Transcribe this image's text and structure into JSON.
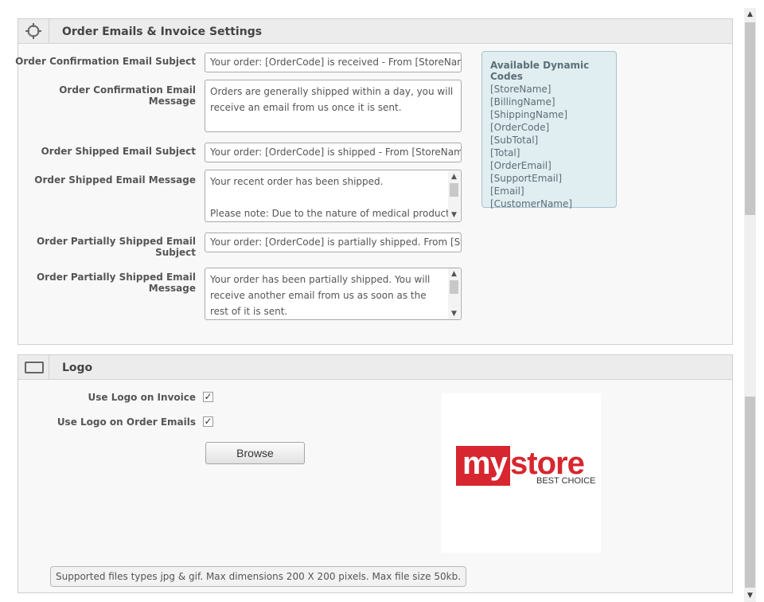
{
  "order_section": {
    "title": "Order Emails & Invoice Settings",
    "icon": "crosshair-icon",
    "fields": {
      "confirm_subject": {
        "label": "Order Confirmation Email Subject",
        "value": "Your order: [OrderCode] is received - From [StoreName]"
      },
      "confirm_message": {
        "label": "Order Confirmation Email Message",
        "value": "Orders are generally shipped within  a day, you will receive an email from us once it is sent."
      },
      "shipped_subject": {
        "label": "Order Shipped Email Subject",
        "value": "Your order: [OrderCode] is shipped - From [StoreName]"
      },
      "shipped_message": {
        "label": "Order Shipped Email Message",
        "line1": "Your recent order has been shipped.",
        "line2": "",
        "line3": "Please note: Due to the nature of medical products, we"
      },
      "partial_subject": {
        "label_line1": "Order Partially Shipped Email",
        "label_line2": "Subject",
        "value": "Your order: [OrderCode] is partially shipped. From [StoreName]"
      },
      "partial_message": {
        "label_line1": "Order Partially Shipped Email",
        "label_line2": "Message",
        "value": "Your order has been partially shipped. You will receive another email from us as soon as the rest of it is sent."
      }
    },
    "codes": {
      "title": "Available Dynamic Codes",
      "items": [
        "[StoreName]",
        "[BillingName]",
        "[ShippingName]",
        "[OrderCode]",
        "[SubTotal]",
        "[Total]",
        "[OrderEmail]",
        "[SupportEmail]",
        "[Email]",
        "[CustomerName]"
      ]
    }
  },
  "logo_section": {
    "title": "Logo",
    "icon": "rectangle-icon",
    "use_on_invoice": {
      "label": "Use Logo on Invoice",
      "checked": true,
      "mark": "✓"
    },
    "use_on_emails": {
      "label": "Use Logo on Order Emails",
      "checked": true,
      "mark": "✓"
    },
    "browse_label": "Browse",
    "logo": {
      "word_my": "my",
      "word_store": "store",
      "tagline": "BEST CHOICE",
      "brand_red": "#d7262f"
    },
    "note": "Supported files types jpg & gif. Max dimensions 200 X 200 pixels. Max file size 50kb."
  },
  "scrollbar": {
    "up_arrow": "▲",
    "down_arrow": "▼"
  }
}
